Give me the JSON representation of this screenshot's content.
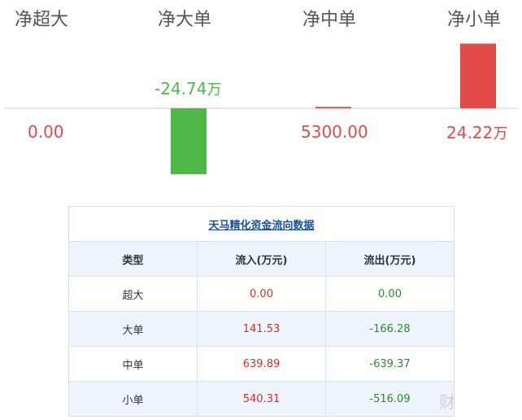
{
  "headers": [
    "净超大",
    "净大单",
    "净中单",
    "净小单"
  ],
  "colors": {
    "positive": "#e24a4a",
    "negative": "#50b848"
  },
  "chart_data": {
    "type": "bar",
    "categories": [
      "净超大",
      "净大单",
      "净中单",
      "净小单"
    ],
    "values_display": [
      "0.00",
      "-24.74",
      "5300.00",
      "24.22"
    ],
    "units_display": [
      "",
      "万",
      "",
      "万"
    ],
    "values_wan": [
      0,
      -24.74,
      0.53,
      24.22
    ]
  },
  "table": {
    "title": "天马精化资金流向数据",
    "columns": [
      "类型",
      "流入(万元)",
      "流出(万元)"
    ],
    "rows": [
      {
        "type": "超大",
        "inflow": "0.00",
        "outflow": "0.00"
      },
      {
        "type": "大单",
        "inflow": "141.53",
        "outflow": "-166.28"
      },
      {
        "type": "中单",
        "inflow": "639.89",
        "outflow": "-639.37"
      },
      {
        "type": "小单",
        "inflow": "540.31",
        "outflow": "-516.09"
      }
    ]
  }
}
